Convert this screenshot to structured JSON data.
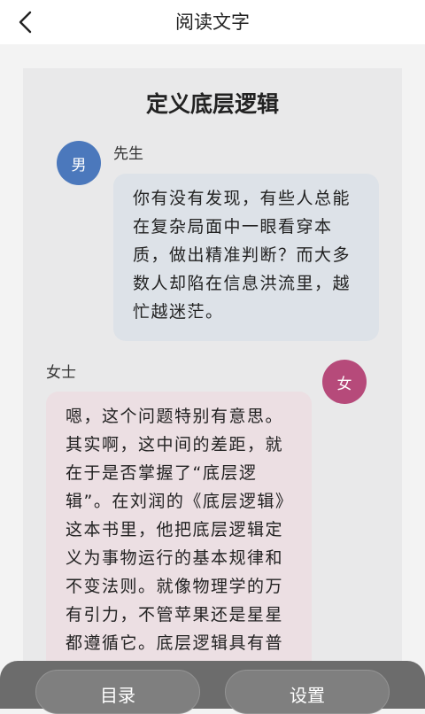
{
  "header": {
    "back_icon": "chevron-left-icon",
    "title": "阅读文字"
  },
  "document": {
    "title": "定义底层逻辑",
    "messages": [
      {
        "speaker": "先生",
        "avatar_text": "男",
        "avatar_color": "#4b78bc",
        "bubble_color": "#dde2e8",
        "text": "你有没有发现，有些人总能在复杂局面中一眼看穿本质，做出精准判断？而大多数人却陷在信息洪流里，越忙越迷茫。"
      },
      {
        "speaker": "女士",
        "avatar_text": "女",
        "avatar_color": "#b64a7a",
        "bubble_color": "#ecdfe3",
        "text": "嗯，这个问题特别有意思。其实啊，这中间的差距，就在于是否掌握了“底层逻辑”。在刘润的《底层逻辑》这本书里，他把底层逻辑定义为事物运行的基本规律和不变法则。就像物理学的万有引力，不管苹果还是星星都遵循它。底层逻辑具有普"
      }
    ]
  },
  "bottom_bar": {
    "catalog_label": "目录",
    "settings_label": "设置"
  }
}
